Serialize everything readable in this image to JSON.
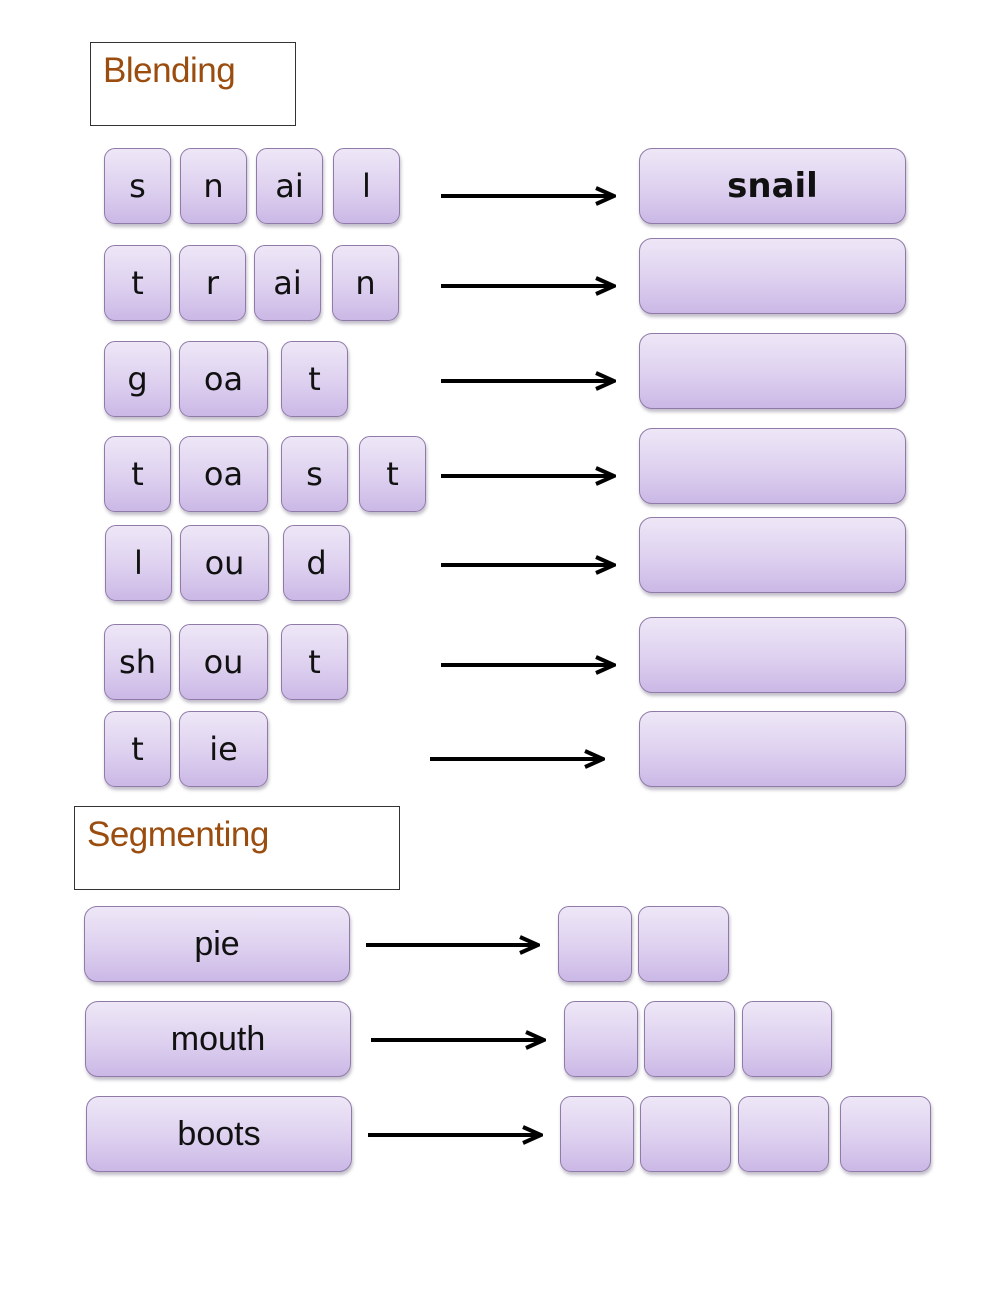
{
  "blending": {
    "title": "Blending",
    "rows": [
      {
        "parts": [
          "s",
          "n",
          "ai",
          "l"
        ],
        "answer": "snail"
      },
      {
        "parts": [
          "t",
          "r",
          "ai",
          "n"
        ],
        "answer": ""
      },
      {
        "parts": [
          "g",
          "oa",
          "t"
        ],
        "answer": ""
      },
      {
        "parts": [
          "t",
          "oa",
          "s",
          "t"
        ],
        "answer": ""
      },
      {
        "parts": [
          "l",
          "ou",
          "d"
        ],
        "answer": ""
      },
      {
        "parts": [
          "sh",
          "ou",
          "t"
        ],
        "answer": ""
      },
      {
        "parts": [
          "t",
          "ie"
        ],
        "answer": ""
      }
    ]
  },
  "segmenting": {
    "title": "Segmenting",
    "rows": [
      {
        "word": "pie",
        "box_count": 2
      },
      {
        "word": "mouth",
        "box_count": 3
      },
      {
        "word": "boots",
        "box_count": 4
      }
    ]
  },
  "colors": {
    "title": "#9a4d0e",
    "tile_border": "#8f7aa8",
    "tile_fill": "#ddd0ef"
  }
}
